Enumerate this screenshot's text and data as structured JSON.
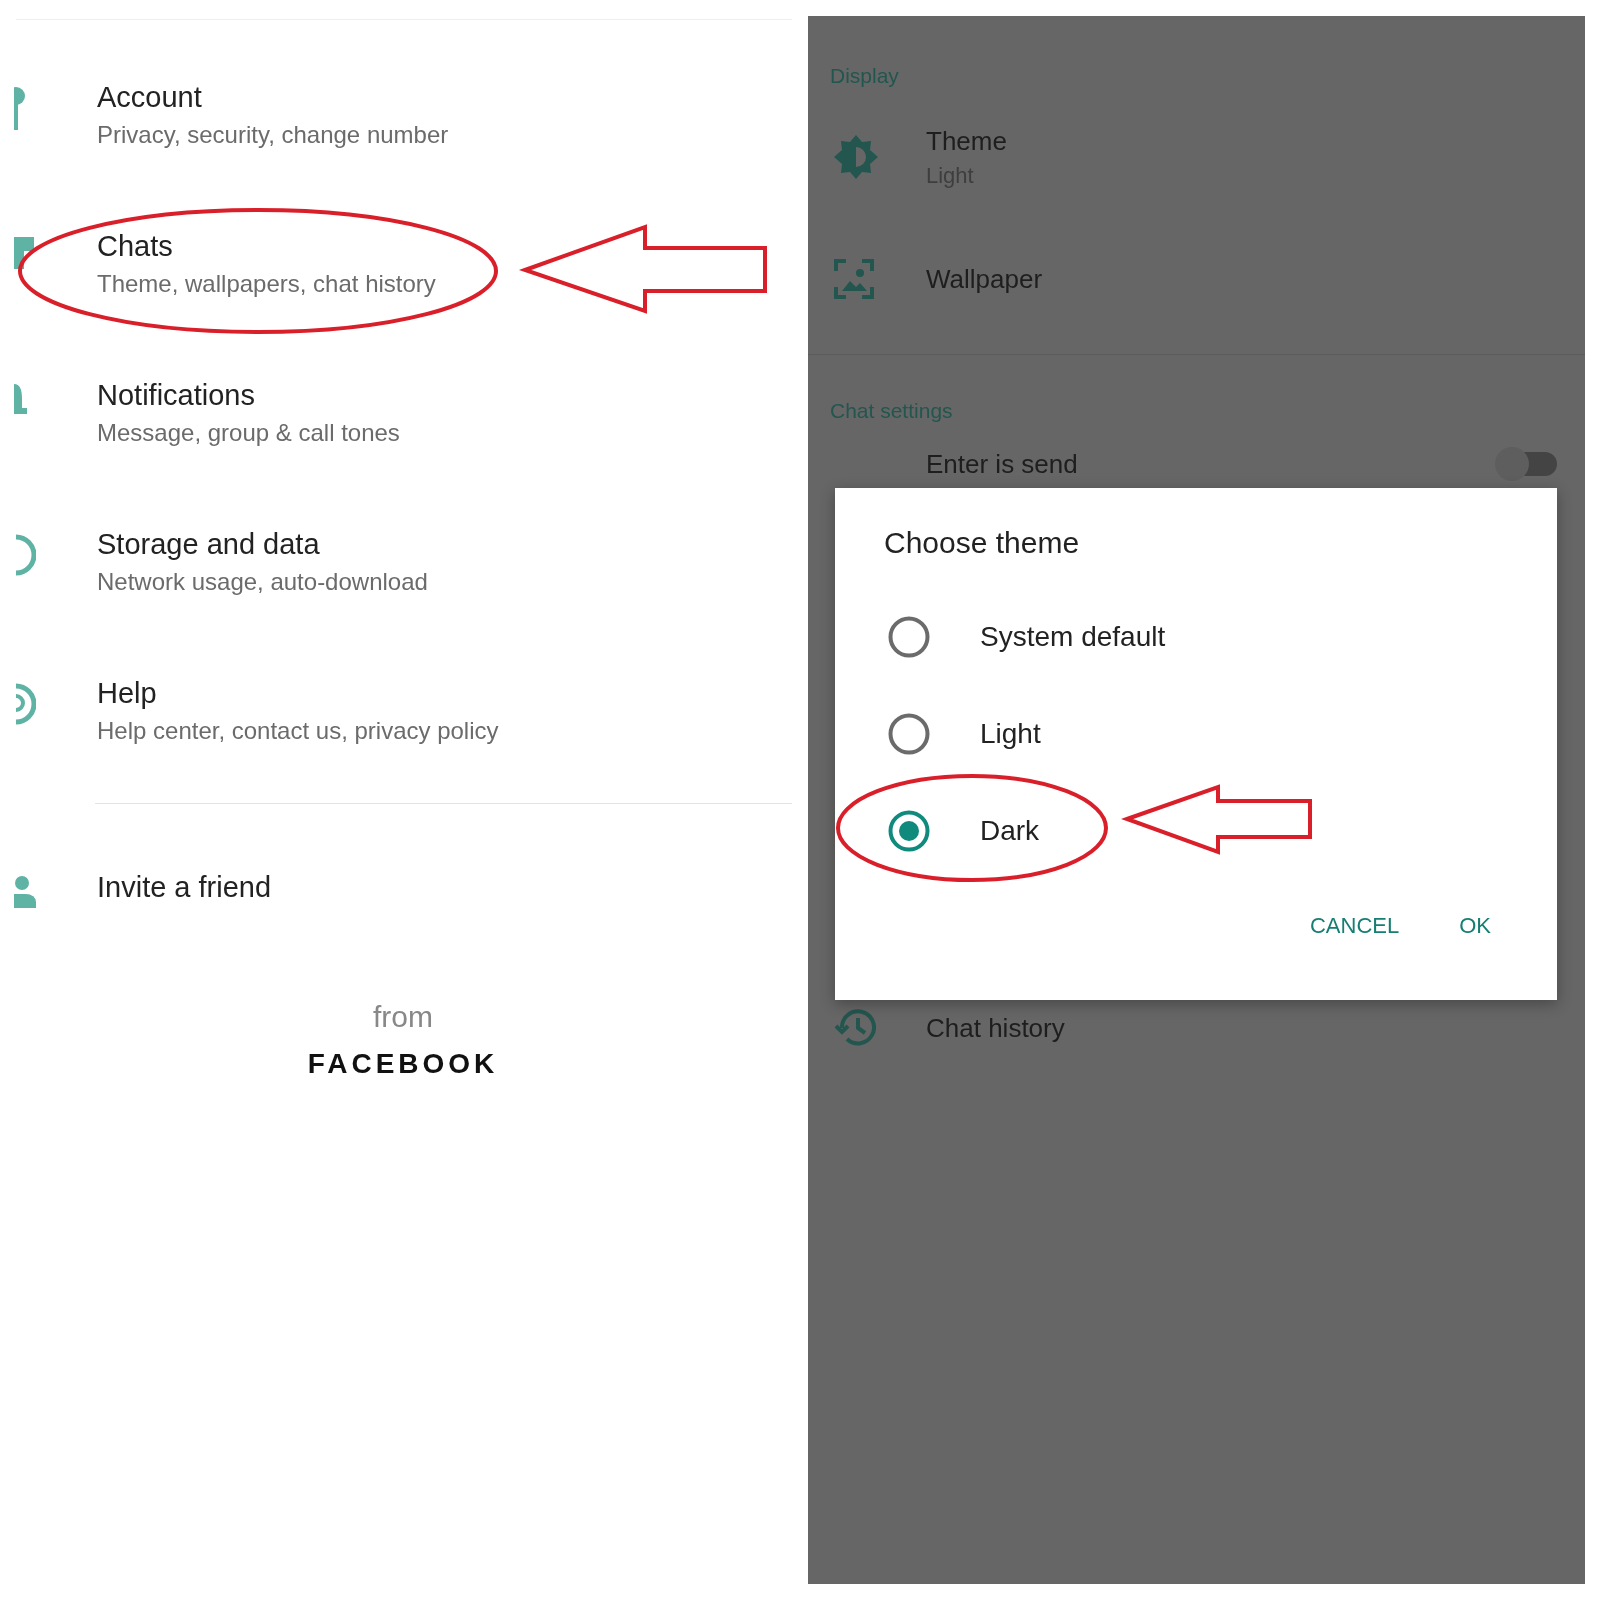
{
  "settings_list": {
    "items": [
      {
        "title": "Account",
        "subtitle": "Privacy, security, change number"
      },
      {
        "title": "Chats",
        "subtitle": "Theme, wallpapers, chat history"
      },
      {
        "title": "Notifications",
        "subtitle": "Message, group & call tones"
      },
      {
        "title": "Storage and data",
        "subtitle": "Network usage, auto-download"
      },
      {
        "title": "Help",
        "subtitle": "Help center, contact us, privacy policy"
      }
    ],
    "invite": {
      "title": "Invite a friend"
    },
    "footer": {
      "from": "from",
      "brand": "FACEBOOK"
    }
  },
  "chat_settings": {
    "sections": [
      {
        "header": "Display",
        "rows": [
          {
            "title": "Theme",
            "subtitle": "Light"
          },
          {
            "title": "Wallpaper"
          }
        ]
      },
      {
        "header": "Chat settings",
        "rows": [
          {
            "title": "Enter is send",
            "toggle": {
              "on": false
            }
          }
        ]
      }
    ],
    "chat_history": {
      "title": "Chat history"
    }
  },
  "dialog": {
    "title": "Choose theme",
    "options": [
      {
        "label": "System default",
        "selected": false
      },
      {
        "label": "Light",
        "selected": false
      },
      {
        "label": "Dark",
        "selected": true
      }
    ],
    "buttons": [
      "CANCEL",
      "OK"
    ]
  }
}
